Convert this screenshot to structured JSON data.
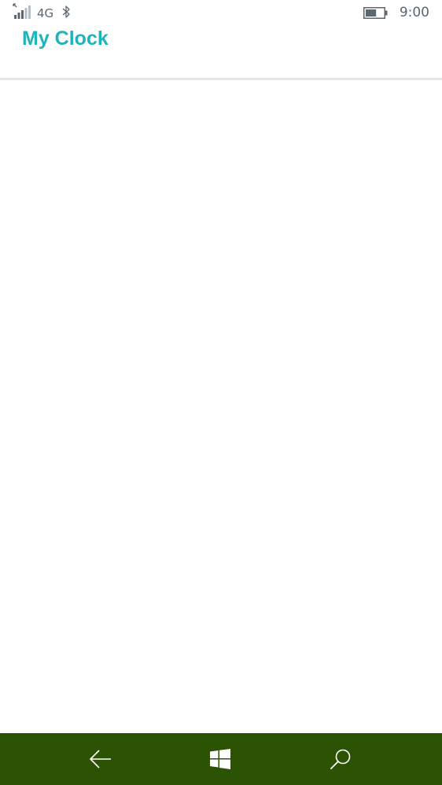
{
  "status_bar": {
    "signal_icon": "signal-bars-icon",
    "network": "4G",
    "bluetooth_icon": "bluetooth-icon",
    "battery_icon": "battery-icon",
    "battery_level": 0.6,
    "time": "9:00"
  },
  "header": {
    "title": "My Clock",
    "accent_color": "#1fb3ba"
  },
  "nav_bar": {
    "background_color": "#2c5203",
    "buttons": [
      "back-arrow-icon",
      "windows-logo-icon",
      "search-icon"
    ]
  }
}
